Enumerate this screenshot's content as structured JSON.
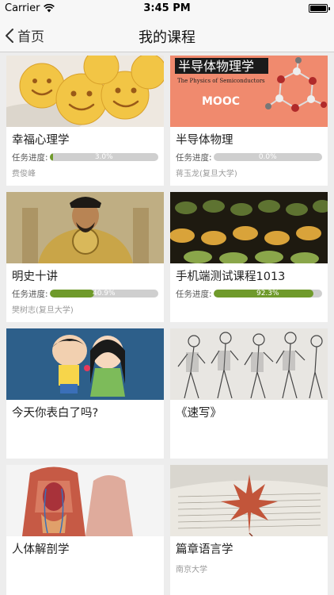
{
  "status": {
    "carrier": "Carrier",
    "time": "3:45 PM"
  },
  "nav": {
    "back_label": "首页",
    "title": "我的课程"
  },
  "progress_label": "任务进度:",
  "courses": [
    {
      "title": "幸福心理学",
      "progress": 3.0,
      "progress_text": "3.0%",
      "teacher": "费俊峰",
      "thumb_text": ""
    },
    {
      "title": "半导体物理",
      "progress": 0.0,
      "progress_text": "0.0%",
      "teacher": "蒋玉龙(复旦大学)",
      "thumb_text": "半导体物理学",
      "thumb_subtext": "The Physics of Semiconductors",
      "thumb_logo": "MOOC"
    },
    {
      "title": "明史十讲",
      "progress": 40.9,
      "progress_text": "40.9%",
      "teacher": "樊树志(复旦大学)"
    },
    {
      "title": "手机端测试课程1013",
      "progress": 92.3,
      "progress_text": "92.3%",
      "teacher": ""
    },
    {
      "title": "今天你表白了吗?",
      "teacher": ""
    },
    {
      "title": "《速写》",
      "teacher": ""
    },
    {
      "title": "人体解剖学",
      "teacher": ""
    },
    {
      "title": "篇章语言学",
      "teacher": "南京大学"
    }
  ],
  "colors": {
    "progress_fill": "#6f9a2b",
    "progress_track": "#cfcfcf",
    "nav_bg": "#f7f7f7"
  }
}
